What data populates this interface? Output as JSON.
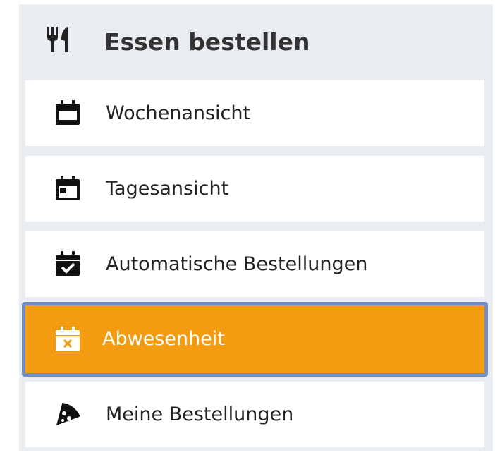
{
  "panel": {
    "header": {
      "title": "Essen bestellen",
      "icon": "utensils-icon"
    },
    "items": [
      {
        "label": "Wochenansicht",
        "icon": "calendar-icon",
        "active": false
      },
      {
        "label": "Tagesansicht",
        "icon": "calendar-day-icon",
        "active": false
      },
      {
        "label": "Automatische Bestellungen",
        "icon": "calendar-check-icon",
        "active": false
      },
      {
        "label": "Abwesenheit",
        "icon": "calendar-times-icon",
        "active": true
      },
      {
        "label": "Meine Bestellungen",
        "icon": "pizza-slice-icon",
        "active": false
      }
    ]
  },
  "colors": {
    "panel_background": "#e9ecf1",
    "item_background": "#ffffff",
    "active_background": "#f39c12",
    "active_border": "#6e8fbf",
    "header_text": "#333333",
    "item_text": "#222222",
    "active_text": "#ffffff"
  }
}
